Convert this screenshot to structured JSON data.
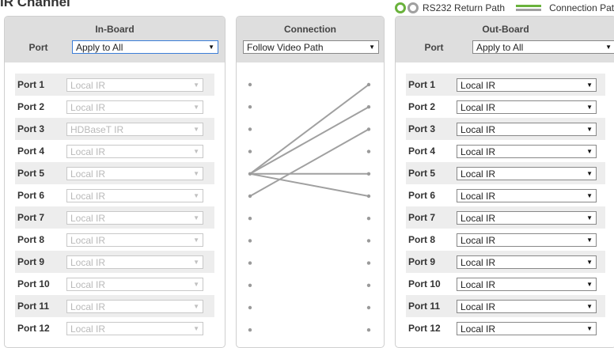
{
  "title": "IR Channel",
  "legend": {
    "rs232": "RS232 Return Path",
    "connection": "Connection Path"
  },
  "inboard": {
    "title": "In-Board",
    "port_label": "Port",
    "apply": "Apply to All",
    "ports": [
      {
        "name": "Port 1",
        "value": "Local IR"
      },
      {
        "name": "Port 2",
        "value": "Local IR"
      },
      {
        "name": "Port 3",
        "value": "HDBaseT IR"
      },
      {
        "name": "Port 4",
        "value": "Local IR"
      },
      {
        "name": "Port 5",
        "value": "Local IR"
      },
      {
        "name": "Port 6",
        "value": "Local IR"
      },
      {
        "name": "Port 7",
        "value": "Local IR"
      },
      {
        "name": "Port 8",
        "value": "Local IR"
      },
      {
        "name": "Port 9",
        "value": "Local IR"
      },
      {
        "name": "Port 10",
        "value": "Local IR"
      },
      {
        "name": "Port 11",
        "value": "Local IR"
      },
      {
        "name": "Port 12",
        "value": "Local IR"
      }
    ]
  },
  "connection": {
    "title": "Connection",
    "mode": "Follow Video Path",
    "links": [
      [
        5,
        1
      ],
      [
        5,
        2
      ],
      [
        6,
        3
      ],
      [
        5,
        5
      ],
      [
        5,
        6
      ]
    ],
    "line_color": "#a0a0a0"
  },
  "outboard": {
    "title": "Out-Board",
    "port_label": "Port",
    "apply": "Apply to All",
    "ports": [
      {
        "name": "Port 1",
        "value": "Local IR"
      },
      {
        "name": "Port 2",
        "value": "Local IR"
      },
      {
        "name": "Port 3",
        "value": "Local IR"
      },
      {
        "name": "Port 4",
        "value": "Local IR"
      },
      {
        "name": "Port 5",
        "value": "Local IR"
      },
      {
        "name": "Port 6",
        "value": "Local IR"
      },
      {
        "name": "Port 7",
        "value": "Local IR"
      },
      {
        "name": "Port 8",
        "value": "Local IR"
      },
      {
        "name": "Port 9",
        "value": "Local IR"
      },
      {
        "name": "Port 10",
        "value": "Local IR"
      },
      {
        "name": "Port 11",
        "value": "Local IR"
      },
      {
        "name": "Port 12",
        "value": "Local IR"
      }
    ]
  }
}
